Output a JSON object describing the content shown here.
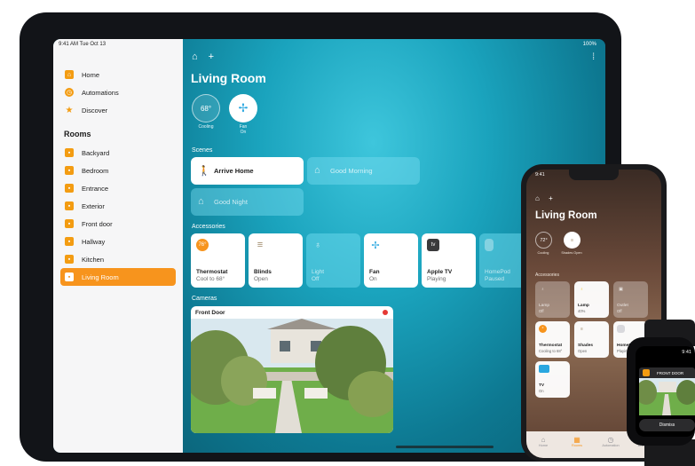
{
  "ipad": {
    "status_time": "9:41 AM  Tue Oct 13",
    "status_battery": "100%",
    "sidebar": {
      "items": [
        {
          "label": "Home",
          "icon": "house-icon"
        },
        {
          "label": "Automations",
          "icon": "clock-icon"
        },
        {
          "label": "Discover",
          "icon": "star-icon"
        }
      ],
      "rooms_title": "Rooms",
      "rooms": [
        {
          "label": "Backyard"
        },
        {
          "label": "Bedroom"
        },
        {
          "label": "Entrance"
        },
        {
          "label": "Exterior"
        },
        {
          "label": "Front door"
        },
        {
          "label": "Hallway"
        },
        {
          "label": "Kitchen"
        },
        {
          "label": "Living Room"
        }
      ],
      "active_room": "Living Room"
    },
    "main": {
      "title": "Living Room",
      "climate": {
        "value": "68°",
        "label": "Cooling"
      },
      "fan": {
        "label": "Fan",
        "state": "On"
      },
      "scenes_title": "Scenes",
      "scenes": [
        {
          "label": "Arrive Home",
          "active": true
        },
        {
          "label": "Good Morning",
          "active": false
        },
        {
          "label": "Good Night",
          "active": false
        }
      ],
      "accessories_title": "Accessories",
      "accessories": [
        {
          "name": "Thermostat",
          "status": "Cool to 68°",
          "badge": "76°",
          "active": true
        },
        {
          "name": "Blinds",
          "status": "Open",
          "active": true
        },
        {
          "name": "Light",
          "status": "Off",
          "active": false
        },
        {
          "name": "Fan",
          "status": "On",
          "active": true
        },
        {
          "name": "Apple TV",
          "status": "Playing",
          "active": true
        },
        {
          "name": "HomePod",
          "status": "Paused",
          "active": false
        }
      ],
      "cameras_title": "Cameras",
      "camera": {
        "label": "Front Door"
      }
    }
  },
  "iphone": {
    "status_time": "9:41",
    "title": "Living Room",
    "climate": {
      "value": "72°",
      "label": "Cooling"
    },
    "shade": {
      "label": "Shades Open"
    },
    "accessories_title": "Accessories",
    "tiles": [
      {
        "name": "Lamp",
        "status": "Off",
        "active": false
      },
      {
        "name": "Lamp",
        "status": "40%",
        "active": true
      },
      {
        "name": "Outlet",
        "status": "Off",
        "active": false
      },
      {
        "name": "Thermostat",
        "status": "Cooling to 68°",
        "active": true
      },
      {
        "name": "Shades",
        "status": "Open",
        "active": true
      },
      {
        "name": "HomePod",
        "status": "Playing",
        "active": true
      },
      {
        "name": "TV",
        "status": "On",
        "active": true
      }
    ],
    "tabs": [
      {
        "label": "Home",
        "active": false
      },
      {
        "label": "Rooms",
        "active": true
      },
      {
        "label": "Automation",
        "active": false
      },
      {
        "label": "Discover",
        "active": false
      }
    ]
  },
  "watch": {
    "time": "9:41",
    "title": "FRONT DOOR",
    "button": "Dismiss"
  },
  "colors": {
    "accent": "#f7941d",
    "main_bg": "#1aa3bd",
    "tile_on": "#ffffff"
  }
}
